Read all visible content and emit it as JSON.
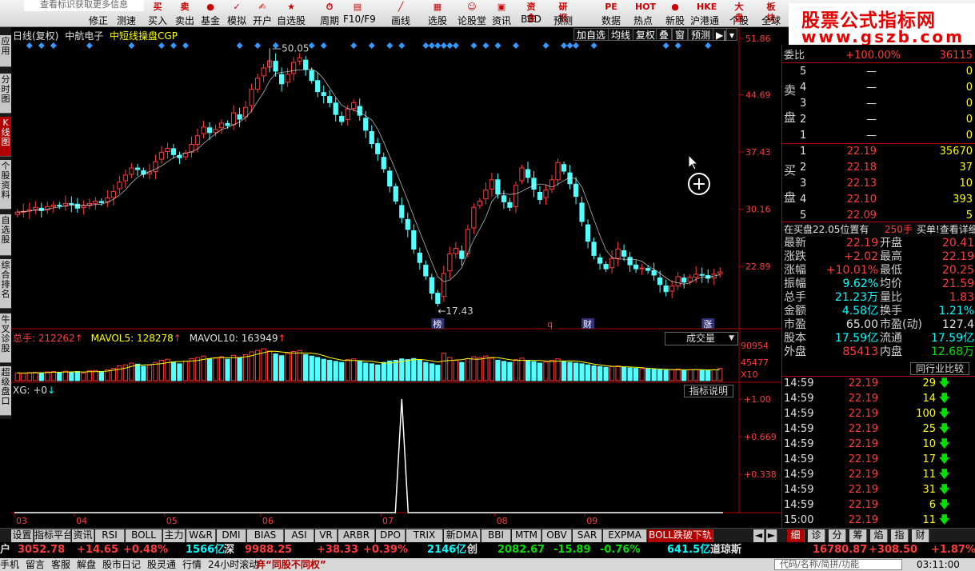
{
  "toolbar": {
    "info_text": "查看标识获取更多信息",
    "buttons": [
      {
        "label": "修正",
        "icon": "wrench-icon",
        "glyph": "✎"
      },
      {
        "label": "测速",
        "icon": "speed-icon",
        "glyph": "◎"
      },
      {
        "label": "买入",
        "icon": "buy-icon",
        "glyph": "买"
      },
      {
        "label": "卖出",
        "icon": "sell-icon",
        "glyph": "卖"
      },
      {
        "label": "基金",
        "icon": "fund-icon",
        "glyph": "●"
      },
      {
        "label": "模拟",
        "icon": "simulate-icon",
        "glyph": "✓"
      },
      {
        "label": "开户",
        "icon": "open-account-icon",
        "glyph": "✍"
      },
      {
        "label": "自选股",
        "icon": "favorite-stock-icon",
        "glyph": "★"
      },
      {
        "label": "周期",
        "icon": "period-icon",
        "glyph": "⏱"
      },
      {
        "label": "F10/F9",
        "icon": "f10-icon",
        "glyph": "▤"
      },
      {
        "label": "画线",
        "icon": "draw-line-icon",
        "glyph": "╱"
      },
      {
        "label": "选股",
        "icon": "select-stock-icon",
        "glyph": "▦"
      },
      {
        "label": "论股堂",
        "icon": "forum-icon",
        "glyph": "☺"
      },
      {
        "label": "资讯",
        "icon": "news-icon",
        "glyph": "▣"
      },
      {
        "label": "BBD",
        "icon": "bbd-icon",
        "glyph": "资金"
      },
      {
        "label": "预测",
        "icon": "forecast-icon",
        "glyph": "研报"
      },
      {
        "label": "数据",
        "icon": "data-icon",
        "glyph": "PE"
      },
      {
        "label": "热点",
        "icon": "hotspot-icon",
        "glyph": "HOT"
      },
      {
        "label": "新股",
        "icon": "ipo-icon",
        "glyph": "●"
      },
      {
        "label": "沪港通",
        "icon": "hk-connect-icon",
        "glyph": "HKE"
      },
      {
        "label": "个股",
        "icon": "individual-stock-icon",
        "glyph": "大盘"
      },
      {
        "label": "全球",
        "icon": "global-icon",
        "glyph": "板块"
      }
    ]
  },
  "watermark": {
    "line1": "股票公式指标网",
    "line2": "www.gszb.com"
  },
  "left_tabs": [
    {
      "label": "应用",
      "active": false
    },
    {
      "label": "分时图",
      "active": false
    },
    {
      "label": "K线图",
      "active": true
    },
    {
      "label": "个股资料",
      "active": false
    },
    {
      "label": "自选股",
      "active": false
    },
    {
      "label": "综合排名",
      "active": false
    },
    {
      "label": "牛叉诊股",
      "active": false
    },
    {
      "label": "超级盘口",
      "active": false
    }
  ],
  "main_chart": {
    "header": {
      "period": "日线(复权)",
      "name": "中航电子",
      "indicator": "中短线操盘CGP"
    },
    "tools": [
      "加自选",
      "均线",
      "复权",
      "叠",
      "窗",
      "预测",
      "▶|",
      "▾"
    ],
    "max_label": "50.05",
    "min_label": "17.43",
    "event_markers": [
      {
        "label": "榜",
        "index": 70
      },
      {
        "label": "q",
        "index": 89
      },
      {
        "label": "财",
        "index": 95
      },
      {
        "label": "涨",
        "index": 115
      }
    ]
  },
  "volume_chart": {
    "total_label": "总手: 212262",
    "mavol5_label": "MAVOL5: 128278",
    "mavol10_label": "MAVOL10: 163949",
    "select_label": "成交量",
    "axis_labels": [
      "90954",
      "45477",
      "X10"
    ]
  },
  "indicator_chart": {
    "label": "XG: +0",
    "button": "指标说明",
    "axis_labels": [
      "+1.00",
      "+0.669",
      "+0.338"
    ]
  },
  "colors": {
    "up": "#ff3b3b",
    "down": "#54ffff",
    "panel_border": "#b00000",
    "marker": "#3399ff",
    "ma_line": "#ffffff"
  },
  "chart_data": {
    "type": "candlestick",
    "ylim": [
      15.5,
      51.86
    ],
    "y_ticks": [
      "51.86",
      "44.69",
      "37.43",
      "30.16",
      "22.89"
    ],
    "y_tick_values": [
      51.86,
      44.69,
      37.43,
      30.16,
      22.89
    ],
    "date_labels": [
      {
        "label": "03",
        "index": 0
      },
      {
        "label": "04",
        "index": 10
      },
      {
        "label": "05",
        "index": 25
      },
      {
        "label": "06",
        "index": 41
      },
      {
        "label": "07",
        "index": 61
      },
      {
        "label": "08",
        "index": 80
      },
      {
        "label": "09",
        "index": 95
      }
    ],
    "close": [
      29.8,
      29.9,
      30.1,
      30.4,
      30.0,
      30.5,
      30.7,
      30.6,
      30.9,
      30.8,
      30.3,
      30.6,
      30.9,
      31.2,
      31.0,
      31.6,
      32.4,
      33.6,
      34.5,
      35.4,
      35.2,
      34.6,
      34.9,
      36.2,
      37.4,
      37.9,
      37.1,
      36.7,
      37.3,
      38.4,
      39.5,
      40.6,
      39.9,
      40.3,
      41.1,
      40.8,
      42.4,
      41.6,
      43.1,
      45.4,
      46.8,
      48.1,
      49.0,
      47.7,
      46.1,
      47.3,
      48.8,
      49.4,
      47.9,
      46.5,
      45.1,
      44.6,
      43.7,
      42.2,
      41.3,
      42.9,
      43.7,
      42.1,
      40.2,
      38.5,
      37.2,
      35.3,
      33.1,
      31.2,
      29.1,
      27.6,
      25.1,
      23.4,
      21.7,
      19.5,
      18.2,
      22.0,
      24.5,
      25.2,
      23.9,
      27.6,
      30.4,
      31.2,
      32.6,
      33.9,
      32.1,
      31.1,
      30.4,
      33.2,
      35.4,
      34.2,
      32.7,
      31.4,
      32.6,
      33.9,
      36.1,
      35.0,
      33.4,
      31.8,
      28.6,
      26.1,
      24.3,
      23.3,
      22.6,
      23.9,
      25.1,
      24.2,
      23.1,
      22.6,
      22.7,
      22.4,
      21.8,
      20.6,
      19.7,
      20.4,
      21.6,
      20.9,
      21.5,
      21.9,
      21.8,
      21.4,
      21.9,
      22.19
    ],
    "volume_scale": 90954,
    "volume": [
      22000,
      21000,
      23000,
      24000,
      22000,
      25000,
      26000,
      23000,
      27000,
      24000,
      26000,
      22000,
      28000,
      29000,
      26000,
      31000,
      35000,
      42000,
      45000,
      50000,
      47000,
      41000,
      44000,
      52000,
      58000,
      61000,
      53000,
      48000,
      55000,
      63000,
      66000,
      70000,
      62000,
      64000,
      68000,
      61000,
      72000,
      65000,
      74000,
      82000,
      86000,
      90954,
      84000,
      76000,
      71000,
      78000,
      83000,
      86000,
      74000,
      70000,
      66000,
      61000,
      58000,
      55000,
      52000,
      60000,
      62000,
      55000,
      50000,
      48000,
      45000,
      52000,
      56000,
      58000,
      62000,
      60000,
      63000,
      58000,
      52000,
      48000,
      44000,
      78000,
      66000,
      58000,
      52000,
      62000,
      68000,
      66000,
      70000,
      64000,
      58000,
      55000,
      52000,
      60000,
      64000,
      58000,
      54000,
      50000,
      53000,
      58000,
      62000,
      56000,
      52000,
      50000,
      48000,
      45000,
      42000,
      40000,
      38000,
      40000,
      42000,
      38000,
      36000,
      35000,
      34000,
      33000,
      32000,
      31000,
      30000,
      31000,
      33000,
      30000,
      31000,
      32000,
      30000,
      29000,
      31000,
      35000
    ],
    "xg_signal_index": 64,
    "xg_range": [
      0,
      1
    ],
    "marker_indices": [
      2,
      4,
      6,
      12,
      19,
      24,
      26,
      28,
      37,
      40,
      43,
      49,
      51,
      56,
      59,
      62,
      64,
      68,
      69,
      70,
      71,
      72,
      73,
      76,
      78,
      80,
      83,
      88,
      91,
      92,
      93,
      96,
      108,
      110,
      115
    ]
  },
  "quote_panel": {
    "weibi": {
      "label": "委比",
      "value": "+100.00%",
      "diff": "36115"
    },
    "sell": {
      "label1": "卖",
      "label2": "盘",
      "levels": [
        {
          "level": "5",
          "price": "—",
          "vol": "0"
        },
        {
          "level": "4",
          "price": "—",
          "vol": "0"
        },
        {
          "level": "3",
          "price": "—",
          "vol": "0"
        },
        {
          "level": "2",
          "price": "—",
          "vol": "0"
        },
        {
          "level": "1",
          "price": "—",
          "vol": "0"
        }
      ]
    },
    "buy": {
      "label1": "买",
      "label2": "盘",
      "levels": [
        {
          "level": "1",
          "price": "22.19",
          "vol": "35670"
        },
        {
          "level": "2",
          "price": "22.18",
          "vol": "37"
        },
        {
          "level": "3",
          "price": "22.13",
          "vol": "10"
        },
        {
          "level": "4",
          "price": "22.10",
          "vol": "393"
        },
        {
          "level": "5",
          "price": "22.09",
          "vol": "5"
        }
      ]
    },
    "notice": {
      "text": "在买盘22.05位置有",
      "qty": "250手",
      "action": "买单!查看详细"
    },
    "stats": [
      {
        "l1": "最新",
        "v1": "22.19",
        "c1": "red",
        "l2": "开盘",
        "v2": "20.41",
        "c2": "red"
      },
      {
        "l1": "涨跌",
        "v1": "+2.02",
        "c1": "red",
        "l2": "最高",
        "v2": "22.19",
        "c2": "red"
      },
      {
        "l1": "涨幅",
        "v1": "+10.01%",
        "c1": "red",
        "l2": "最低",
        "v2": "20.25",
        "c2": "red"
      },
      {
        "l1": "振幅",
        "v1": "9.62%",
        "c1": "cyan",
        "l2": "均价",
        "v2": "21.59",
        "c2": "red"
      },
      {
        "l1": "总手",
        "v1": "21.23万",
        "c1": "cyan",
        "l2": "量比",
        "v2": "1.83",
        "c2": "red"
      },
      {
        "l1": "金额",
        "v1": "4.58亿",
        "c1": "cyan",
        "l2": "换手",
        "v2": "1.21%",
        "c2": "cyan"
      },
      {
        "l1": "市盈",
        "v1": "65.00",
        "c1": "white",
        "l2": "市盈(动)",
        "v2": "127.4",
        "c2": "white"
      },
      {
        "l1": "股本",
        "v1": "17.59亿",
        "c1": "cyan",
        "l2": "流通",
        "v2": "17.59亿",
        "c2": "cyan"
      },
      {
        "l1": "外盘",
        "v1": "85413",
        "c1": "red",
        "l2": "内盘",
        "v2": "12.68万",
        "c2": "green"
      }
    ],
    "compare_button": "同行业比较",
    "trades": [
      {
        "time": "14:59",
        "price": "22.19",
        "vol": "29"
      },
      {
        "time": "14:59",
        "price": "22.19",
        "vol": "14"
      },
      {
        "time": "14:59",
        "price": "22.19",
        "vol": "100"
      },
      {
        "time": "14:59",
        "price": "22.19",
        "vol": "25"
      },
      {
        "time": "14:59",
        "price": "22.19",
        "vol": "10"
      },
      {
        "time": "14:59",
        "price": "22.19",
        "vol": "17"
      },
      {
        "time": "14:59",
        "price": "22.19",
        "vol": "11"
      },
      {
        "time": "14:59",
        "price": "22.19",
        "vol": "31"
      },
      {
        "time": "14:59",
        "price": "22.19",
        "vol": "6"
      },
      {
        "time": "15:00",
        "price": "22.19",
        "vol": "11"
      }
    ]
  },
  "bottom_tabs": [
    "设置",
    "指标平台",
    "资讯",
    "RSI",
    "BOLL",
    "主力",
    "W&R",
    "DMI",
    "BIAS",
    "ASI",
    "VR",
    "ARBR",
    "DPO",
    "TRIX",
    "新DMA",
    "BBI",
    "MTM",
    "OBV",
    "SAR",
    "EXPMA",
    "BOLL跌破下轨"
  ],
  "right_bottom_tabs": [
    "细",
    "诊",
    "分",
    "筹",
    "焰",
    "指",
    "财"
  ],
  "status": {
    "sh_label": "户",
    "sh_index": "3052.78",
    "sh_change": "+14.65",
    "sh_pct": "+0.48%",
    "sh_amount": "1566亿",
    "sz_label": "深",
    "sz_index": "9988.25",
    "sz_change": "+38.33",
    "sz_pct": "+0.39%",
    "cy_amount": "2146亿",
    "cy_label": "创",
    "cy_index": "2082.67",
    "cy_change": "-15.89",
    "cy_pct": "-0.76%",
    "dj_amount": "641.5亿",
    "dj_label": "道琼斯",
    "dj_index": "16780.87",
    "dj_change": "+308.50",
    "dj_pct": "+1.87%"
  },
  "bottom_bar": {
    "items": [
      "手机",
      "留言",
      "客服",
      "解盘",
      "股市日记",
      "股灵通",
      "行情",
      "24小时滚动"
    ],
    "ticker": "弃“同股不同权”",
    "search_placeholder": "代码/名称/简拼/功能",
    "clock": "03:11:00"
  }
}
